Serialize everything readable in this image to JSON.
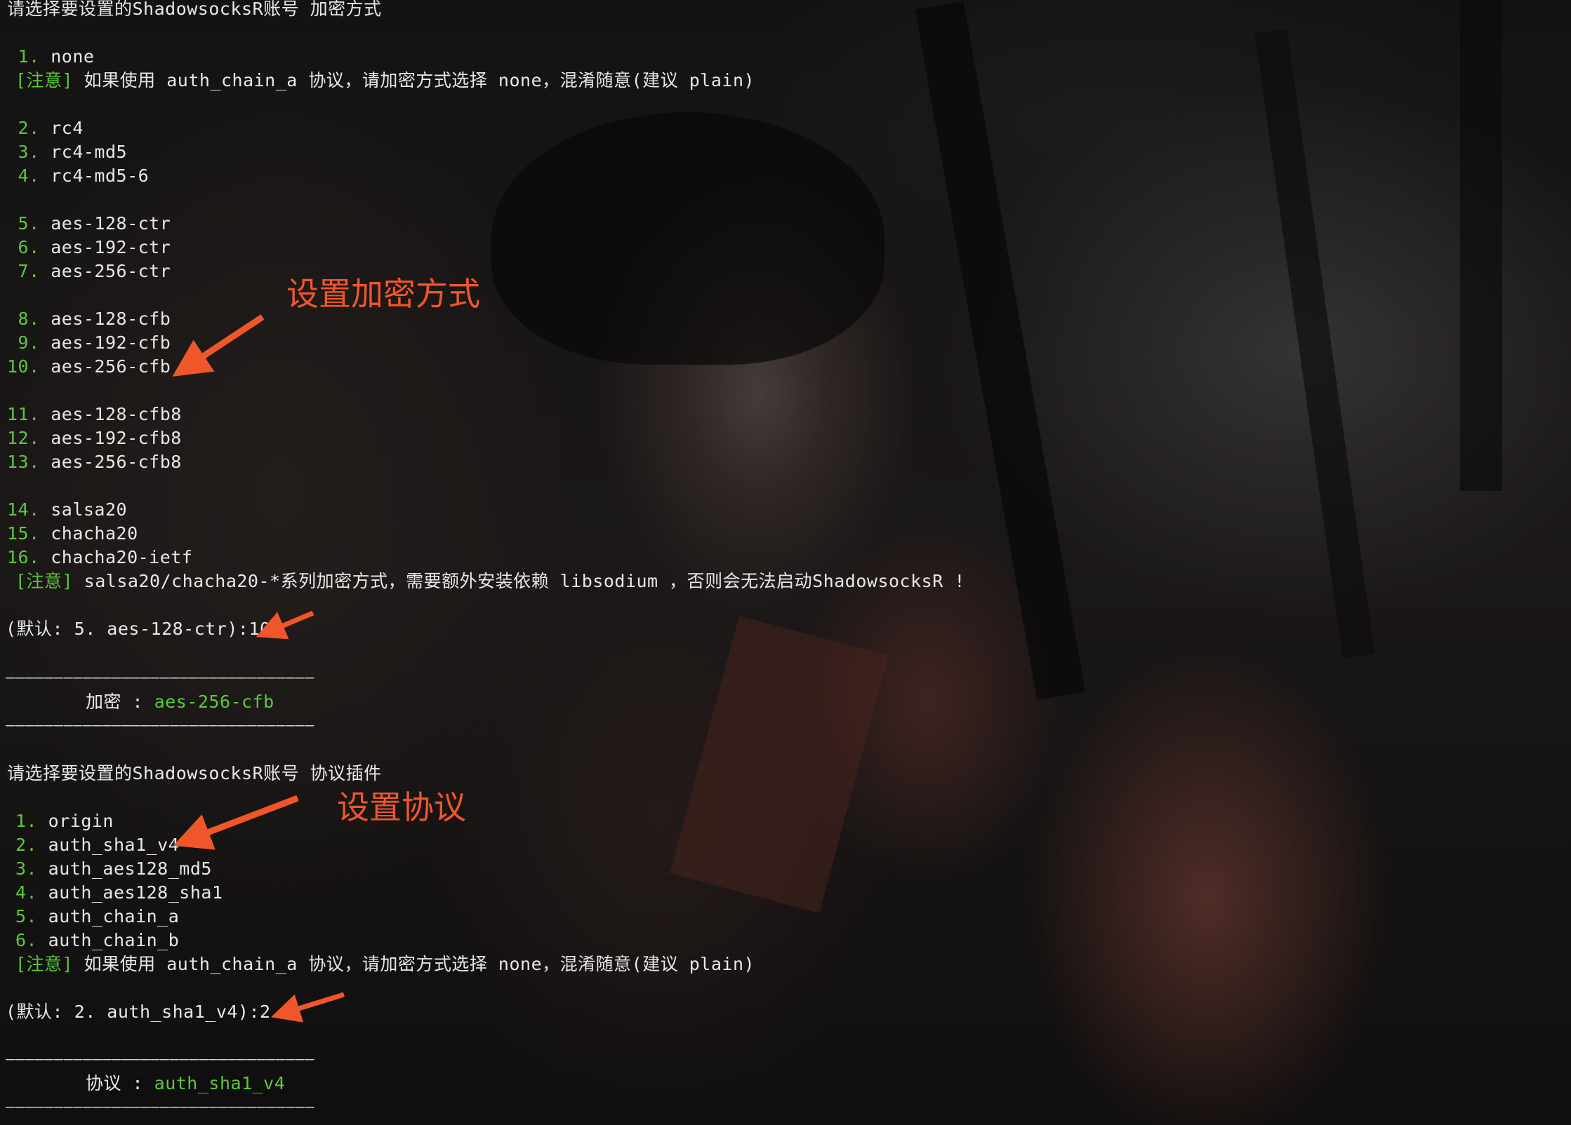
{
  "encryption": {
    "prompt": "请选择要设置的ShadowsocksR账号 加密方式",
    "options": [
      {
        "num": " 1.",
        "label": "none"
      },
      {
        "num": " 2.",
        "label": "rc4"
      },
      {
        "num": " 3.",
        "label": "rc4-md5"
      },
      {
        "num": " 4.",
        "label": "rc4-md5-6"
      },
      {
        "num": " 5.",
        "label": "aes-128-ctr"
      },
      {
        "num": " 6.",
        "label": "aes-192-ctr"
      },
      {
        "num": " 7.",
        "label": "aes-256-ctr"
      },
      {
        "num": " 8.",
        "label": "aes-128-cfb"
      },
      {
        "num": " 9.",
        "label": "aes-192-cfb"
      },
      {
        "num": "10.",
        "label": "aes-256-cfb"
      },
      {
        "num": "11.",
        "label": "aes-128-cfb8"
      },
      {
        "num": "12.",
        "label": "aes-192-cfb8"
      },
      {
        "num": "13.",
        "label": "aes-256-cfb8"
      },
      {
        "num": "14.",
        "label": "salsa20"
      },
      {
        "num": "15.",
        "label": "chacha20"
      },
      {
        "num": "16.",
        "label": "chacha20-ietf"
      }
    ],
    "note_tag": "[注意]",
    "note1": " 如果使用 auth_chain_a 协议，请加密方式选择 none，混淆随意(建议 plain)",
    "note2": " salsa20/chacha20-*系列加密方式，需要额外安装依赖 libsodium ，否则会无法启动ShadowsocksR !",
    "default_prompt": "(默认: 5. aes-128-ctr):10",
    "separator": "————————————————————————————————",
    "result_label": "加密 : ",
    "result_value": "aes-256-cfb"
  },
  "protocol": {
    "prompt": "请选择要设置的ShadowsocksR账号 协议插件",
    "options": [
      {
        "num": "1.",
        "label": "origin"
      },
      {
        "num": "2.",
        "label": "auth_sha1_v4"
      },
      {
        "num": "3.",
        "label": "auth_aes128_md5"
      },
      {
        "num": "4.",
        "label": "auth_aes128_sha1"
      },
      {
        "num": "5.",
        "label": "auth_chain_a"
      },
      {
        "num": "6.",
        "label": "auth_chain_b"
      }
    ],
    "note_tag": "[注意]",
    "note": " 如果使用 auth_chain_a 协议，请加密方式选择 none，混淆随意(建议 plain)",
    "default_prompt": "(默认: 2. auth_sha1_v4):2",
    "separator": "————————————————————————————————",
    "result_label": "协议 : ",
    "result_value": "auth_sha1_v4"
  },
  "annotations": {
    "encryption_label": "设置加密方式",
    "protocol_label": "设置协议"
  },
  "colors": {
    "highlight_green": "#5cc83c",
    "annotation_orange": "#f0562a",
    "terminal_text": "#e8e8e8"
  }
}
